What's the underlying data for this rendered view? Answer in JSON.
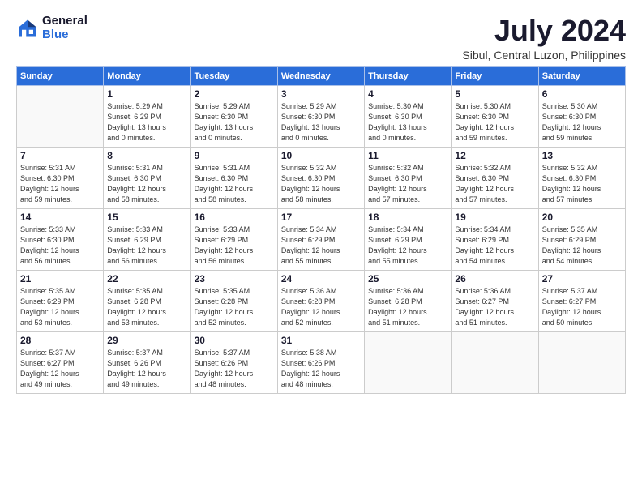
{
  "logo": {
    "general": "General",
    "blue": "Blue"
  },
  "title": "July 2024",
  "location": "Sibul, Central Luzon, Philippines",
  "headers": [
    "Sunday",
    "Monday",
    "Tuesday",
    "Wednesday",
    "Thursday",
    "Friday",
    "Saturday"
  ],
  "weeks": [
    [
      {
        "day": "",
        "info": ""
      },
      {
        "day": "1",
        "info": "Sunrise: 5:29 AM\nSunset: 6:29 PM\nDaylight: 13 hours\nand 0 minutes."
      },
      {
        "day": "2",
        "info": "Sunrise: 5:29 AM\nSunset: 6:30 PM\nDaylight: 13 hours\nand 0 minutes."
      },
      {
        "day": "3",
        "info": "Sunrise: 5:29 AM\nSunset: 6:30 PM\nDaylight: 13 hours\nand 0 minutes."
      },
      {
        "day": "4",
        "info": "Sunrise: 5:30 AM\nSunset: 6:30 PM\nDaylight: 13 hours\nand 0 minutes."
      },
      {
        "day": "5",
        "info": "Sunrise: 5:30 AM\nSunset: 6:30 PM\nDaylight: 12 hours\nand 59 minutes."
      },
      {
        "day": "6",
        "info": "Sunrise: 5:30 AM\nSunset: 6:30 PM\nDaylight: 12 hours\nand 59 minutes."
      }
    ],
    [
      {
        "day": "7",
        "info": "Sunrise: 5:31 AM\nSunset: 6:30 PM\nDaylight: 12 hours\nand 59 minutes."
      },
      {
        "day": "8",
        "info": "Sunrise: 5:31 AM\nSunset: 6:30 PM\nDaylight: 12 hours\nand 58 minutes."
      },
      {
        "day": "9",
        "info": "Sunrise: 5:31 AM\nSunset: 6:30 PM\nDaylight: 12 hours\nand 58 minutes."
      },
      {
        "day": "10",
        "info": "Sunrise: 5:32 AM\nSunset: 6:30 PM\nDaylight: 12 hours\nand 58 minutes."
      },
      {
        "day": "11",
        "info": "Sunrise: 5:32 AM\nSunset: 6:30 PM\nDaylight: 12 hours\nand 57 minutes."
      },
      {
        "day": "12",
        "info": "Sunrise: 5:32 AM\nSunset: 6:30 PM\nDaylight: 12 hours\nand 57 minutes."
      },
      {
        "day": "13",
        "info": "Sunrise: 5:32 AM\nSunset: 6:30 PM\nDaylight: 12 hours\nand 57 minutes."
      }
    ],
    [
      {
        "day": "14",
        "info": "Sunrise: 5:33 AM\nSunset: 6:30 PM\nDaylight: 12 hours\nand 56 minutes."
      },
      {
        "day": "15",
        "info": "Sunrise: 5:33 AM\nSunset: 6:29 PM\nDaylight: 12 hours\nand 56 minutes."
      },
      {
        "day": "16",
        "info": "Sunrise: 5:33 AM\nSunset: 6:29 PM\nDaylight: 12 hours\nand 56 minutes."
      },
      {
        "day": "17",
        "info": "Sunrise: 5:34 AM\nSunset: 6:29 PM\nDaylight: 12 hours\nand 55 minutes."
      },
      {
        "day": "18",
        "info": "Sunrise: 5:34 AM\nSunset: 6:29 PM\nDaylight: 12 hours\nand 55 minutes."
      },
      {
        "day": "19",
        "info": "Sunrise: 5:34 AM\nSunset: 6:29 PM\nDaylight: 12 hours\nand 54 minutes."
      },
      {
        "day": "20",
        "info": "Sunrise: 5:35 AM\nSunset: 6:29 PM\nDaylight: 12 hours\nand 54 minutes."
      }
    ],
    [
      {
        "day": "21",
        "info": "Sunrise: 5:35 AM\nSunset: 6:29 PM\nDaylight: 12 hours\nand 53 minutes."
      },
      {
        "day": "22",
        "info": "Sunrise: 5:35 AM\nSunset: 6:28 PM\nDaylight: 12 hours\nand 53 minutes."
      },
      {
        "day": "23",
        "info": "Sunrise: 5:35 AM\nSunset: 6:28 PM\nDaylight: 12 hours\nand 52 minutes."
      },
      {
        "day": "24",
        "info": "Sunrise: 5:36 AM\nSunset: 6:28 PM\nDaylight: 12 hours\nand 52 minutes."
      },
      {
        "day": "25",
        "info": "Sunrise: 5:36 AM\nSunset: 6:28 PM\nDaylight: 12 hours\nand 51 minutes."
      },
      {
        "day": "26",
        "info": "Sunrise: 5:36 AM\nSunset: 6:27 PM\nDaylight: 12 hours\nand 51 minutes."
      },
      {
        "day": "27",
        "info": "Sunrise: 5:37 AM\nSunset: 6:27 PM\nDaylight: 12 hours\nand 50 minutes."
      }
    ],
    [
      {
        "day": "28",
        "info": "Sunrise: 5:37 AM\nSunset: 6:27 PM\nDaylight: 12 hours\nand 49 minutes."
      },
      {
        "day": "29",
        "info": "Sunrise: 5:37 AM\nSunset: 6:26 PM\nDaylight: 12 hours\nand 49 minutes."
      },
      {
        "day": "30",
        "info": "Sunrise: 5:37 AM\nSunset: 6:26 PM\nDaylight: 12 hours\nand 48 minutes."
      },
      {
        "day": "31",
        "info": "Sunrise: 5:38 AM\nSunset: 6:26 PM\nDaylight: 12 hours\nand 48 minutes."
      },
      {
        "day": "",
        "info": ""
      },
      {
        "day": "",
        "info": ""
      },
      {
        "day": "",
        "info": ""
      }
    ]
  ]
}
